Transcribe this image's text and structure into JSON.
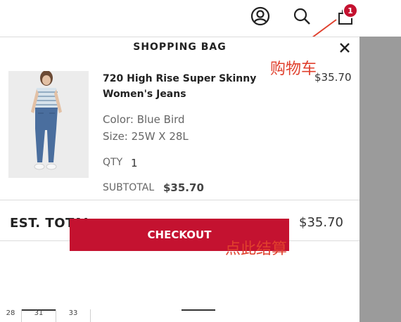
{
  "header": {
    "account_icon": "account-circle-icon",
    "search_icon": "search-icon",
    "bag_icon": "shopping-bag-icon",
    "bag_count": "1"
  },
  "bag": {
    "title": "SHOPPING BAG",
    "close_icon": "close-icon",
    "item": {
      "name_line1": "720 High Rise Super Skinny",
      "name_line2": "Women's Jeans",
      "price": "$35.70",
      "color": "Color: Blue Bird",
      "size": "Size: 25W X 28L",
      "qty_label": "QTY",
      "qty_value": "1",
      "subtotal_label": "SUBTOTAL",
      "subtotal_value": "$35.70"
    },
    "est_total_label": "EST. TOTAL",
    "est_total_value": "$35.70",
    "checkout_label": "CHECKOUT"
  },
  "annotations": {
    "cart": "购物车",
    "checkout_hint": "点此结算"
  },
  "colors": {
    "accent": "#c41230",
    "annotation": "#e0402d",
    "overlay": "#9b9b9b"
  },
  "size_strip": [
    "28",
    "31",
    "33"
  ]
}
